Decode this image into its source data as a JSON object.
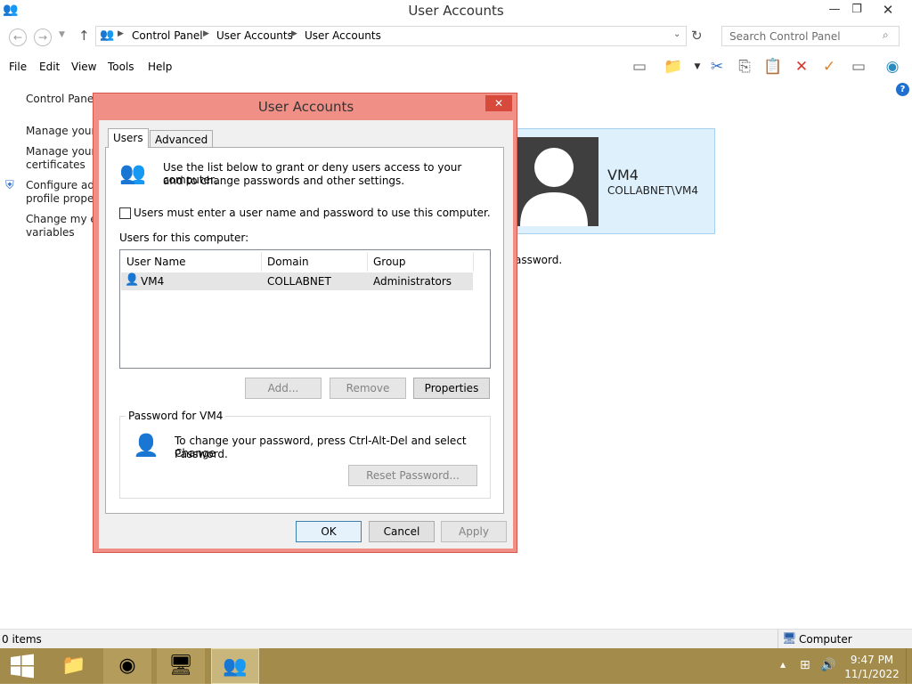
{
  "window": {
    "title": "User Accounts"
  },
  "address": {
    "breadcrumb": [
      "Control Panel",
      "User Accounts",
      "User Accounts"
    ]
  },
  "search": {
    "placeholder": "Search Control Panel"
  },
  "menu": [
    "File",
    "Edit",
    "View",
    "Tools",
    "Help"
  ],
  "left_panel": {
    "home": "Control Panel",
    "links": [
      "Manage your c",
      "Manage your f",
      "certificates",
      "Configure adv",
      "profile propert",
      "Change my en",
      "variables"
    ]
  },
  "user_card": {
    "name": "VM4",
    "account": "COLLABNET\\VM4"
  },
  "behind_text": "assword.",
  "dialog": {
    "title": "User Accounts",
    "tabs": [
      "Users",
      "Advanced"
    ],
    "intro": [
      "Use the list below to grant or deny users access to your computer,",
      "and to change passwords and other settings."
    ],
    "checkbox_label": "Users must enter a user name and password to use this computer.",
    "users_label": "Users for this computer:",
    "columns": [
      "User Name",
      "Domain",
      "Group"
    ],
    "users": [
      {
        "name": "VM4",
        "domain": "COLLABNET",
        "group": "Administrators"
      }
    ],
    "buttons": {
      "add": "Add...",
      "remove": "Remove",
      "properties": "Properties"
    },
    "password_group": {
      "title": "Password for VM4",
      "text": [
        "To change your password, press Ctrl-Alt-Del and select Change",
        "Password."
      ],
      "reset": "Reset Password..."
    },
    "footer": {
      "ok": "OK",
      "cancel": "Cancel",
      "apply": "Apply"
    }
  },
  "status": {
    "items": "0 items",
    "location": "Computer"
  },
  "taskbar": {
    "time": "9:47 PM",
    "date": "11/1/2022"
  },
  "icons": {
    "accent": "#ef8f86",
    "taskbar": "#a38c4b"
  }
}
